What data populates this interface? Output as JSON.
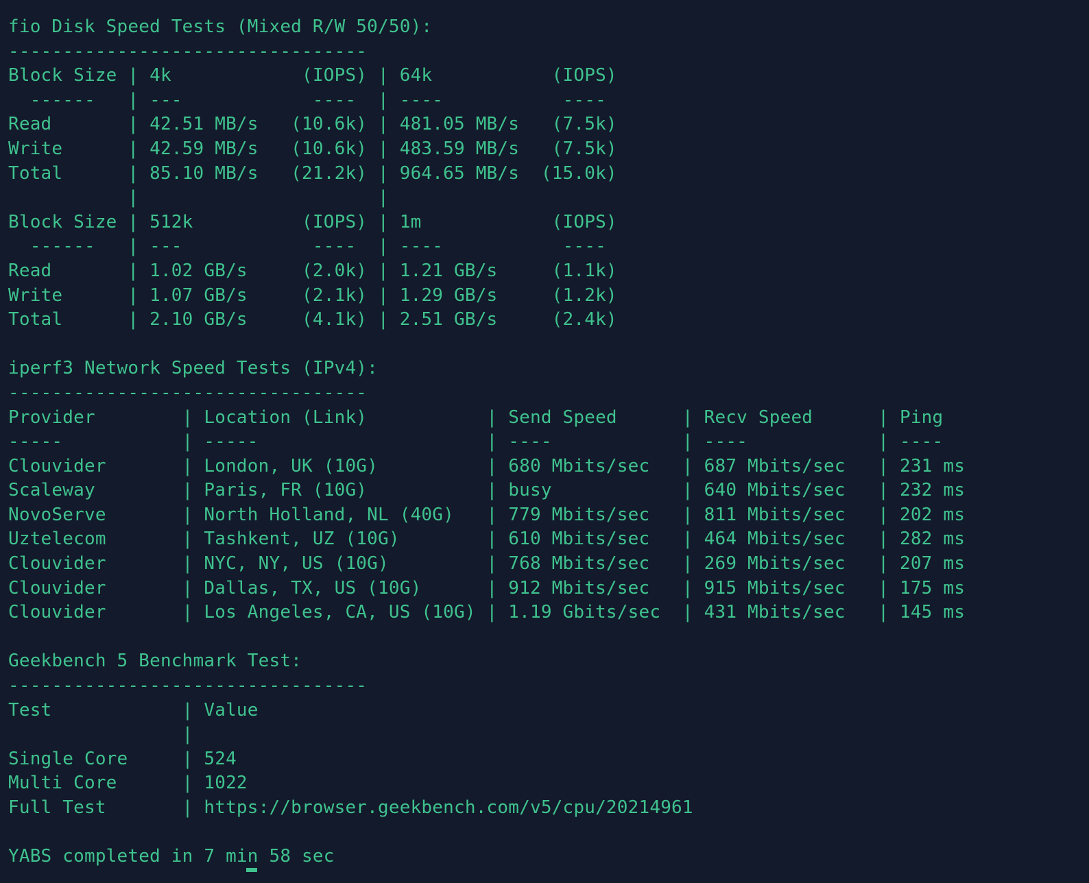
{
  "terminal": {
    "lines": [
      "fio Disk Speed Tests (Mixed R/W 50/50):",
      "---------------------------------",
      "Block Size | 4k            (IOPS) | 64k           (IOPS)",
      "  ------   | ---            ----  | ----           ----",
      "Read       | 42.51 MB/s   (10.6k) | 481.05 MB/s   (7.5k)",
      "Write      | 42.59 MB/s   (10.6k) | 483.59 MB/s   (7.5k)",
      "Total      | 85.10 MB/s   (21.2k) | 964.65 MB/s  (15.0k)",
      "           |                      |",
      "Block Size | 512k          (IOPS) | 1m            (IOPS)",
      "  ------   | ---            ----  | ----           ----",
      "Read       | 1.02 GB/s     (2.0k) | 1.21 GB/s     (1.1k)",
      "Write      | 1.07 GB/s     (2.1k) | 1.29 GB/s     (1.2k)",
      "Total      | 2.10 GB/s     (4.1k) | 2.51 GB/s     (2.4k)",
      "",
      "iperf3 Network Speed Tests (IPv4):",
      "---------------------------------",
      "Provider        | Location (Link)           | Send Speed      | Recv Speed      | Ping",
      "-----           | -----                     | ----            | ----            | ----",
      "Clouvider       | London, UK (10G)          | 680 Mbits/sec   | 687 Mbits/sec   | 231 ms",
      "Scaleway        | Paris, FR (10G)           | busy            | 640 Mbits/sec   | 232 ms",
      "NovoServe       | North Holland, NL (40G)   | 779 Mbits/sec   | 811 Mbits/sec   | 202 ms",
      "Uztelecom       | Tashkent, UZ (10G)        | 610 Mbits/sec   | 464 Mbits/sec   | 282 ms",
      "Clouvider       | NYC, NY, US (10G)         | 768 Mbits/sec   | 269 Mbits/sec   | 207 ms",
      "Clouvider       | Dallas, TX, US (10G)      | 912 Mbits/sec   | 915 Mbits/sec   | 175 ms",
      "Clouvider       | Los Angeles, CA, US (10G) | 1.19 Gbits/sec  | 431 Mbits/sec   | 145 ms",
      "",
      "Geekbench 5 Benchmark Test:",
      "---------------------------------",
      "Test            | Value",
      "                |",
      "Single Core     | 524",
      "Multi Core      | 1022",
      "Full Test       | https://browser.geekbench.com/v5/cpu/20214961",
      "",
      "YABS completed in 7 min 58 sec"
    ]
  }
}
